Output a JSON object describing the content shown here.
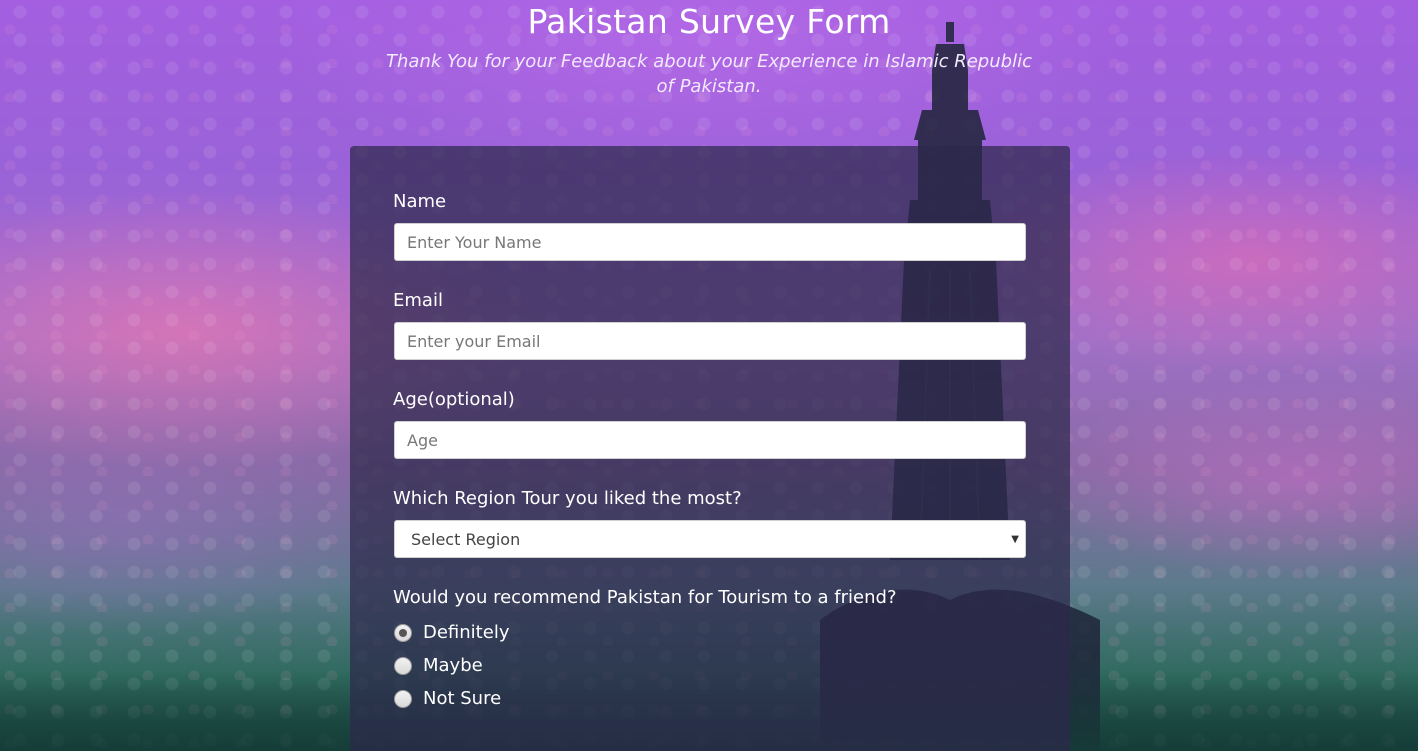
{
  "header": {
    "title": "Pakistan Survey Form",
    "subtitle": "Thank You for your Feedback about your Experience in Islamic Republic of Pakistan."
  },
  "form": {
    "name": {
      "label": "Name",
      "placeholder": "Enter Your Name",
      "value": ""
    },
    "email": {
      "label": "Email",
      "placeholder": "Enter your Email",
      "value": ""
    },
    "age": {
      "label": "Age(optional)",
      "placeholder": "Age",
      "value": ""
    },
    "region": {
      "label": "Which Region Tour you liked the most?",
      "selected": "Select Region"
    },
    "recommend": {
      "label": "Would you recommend Pakistan for Tourism to a friend?",
      "options": [
        {
          "label": "Definitely",
          "checked": true
        },
        {
          "label": "Maybe",
          "checked": false
        },
        {
          "label": "Not Sure",
          "checked": false
        }
      ]
    }
  },
  "theme": {
    "card_background": "#2d284b",
    "text": "#ffffff",
    "input_background": "#ffffff"
  },
  "icons": {
    "select_caret": "caret-down-icon"
  }
}
